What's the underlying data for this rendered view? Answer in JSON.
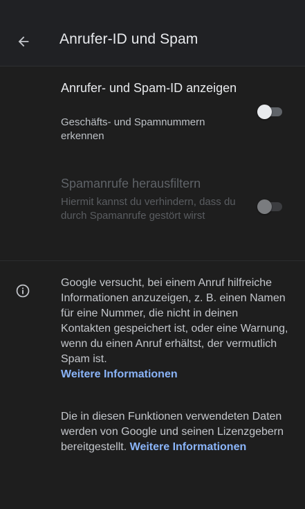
{
  "app_bar": {
    "title": "Anrufer-ID und Spam",
    "back_icon": "arrow-back-icon"
  },
  "settings": [
    {
      "title": "Anrufer- und Spam-ID anzeigen",
      "summary": "Geschäfts- und Spamnummern erkennen",
      "enabled": true,
      "checked": false
    },
    {
      "title": "Spamanrufe herausfiltern",
      "summary": "Hiermit kannst du verhindern, dass du durch Spamanrufe gestört wirst",
      "enabled": false,
      "checked": false
    }
  ],
  "info": {
    "icon": "info-icon",
    "paragraph1": "Google versucht, bei einem Anruf hilfreiche Informationen anzuzeigen, z. B. einen Namen für eine Nummer, die nicht in deinen Kontakten gespeichert ist, oder eine Warnung, wenn du einen Anruf erhältst, der vermutlich Spam ist.",
    "link1": "Weitere Informationen",
    "paragraph2": "Die in diesen Funktionen verwendeten Daten werden von Google und seinen Lizenzgebern bereitgestellt.",
    "link2": "Weitere Informationen"
  },
  "colors": {
    "background": "#1e1e1e",
    "app_bar": "#202124",
    "link": "#8ab4f8",
    "primary_text": "#e8eaed",
    "secondary_text": "#bdc1c6"
  }
}
